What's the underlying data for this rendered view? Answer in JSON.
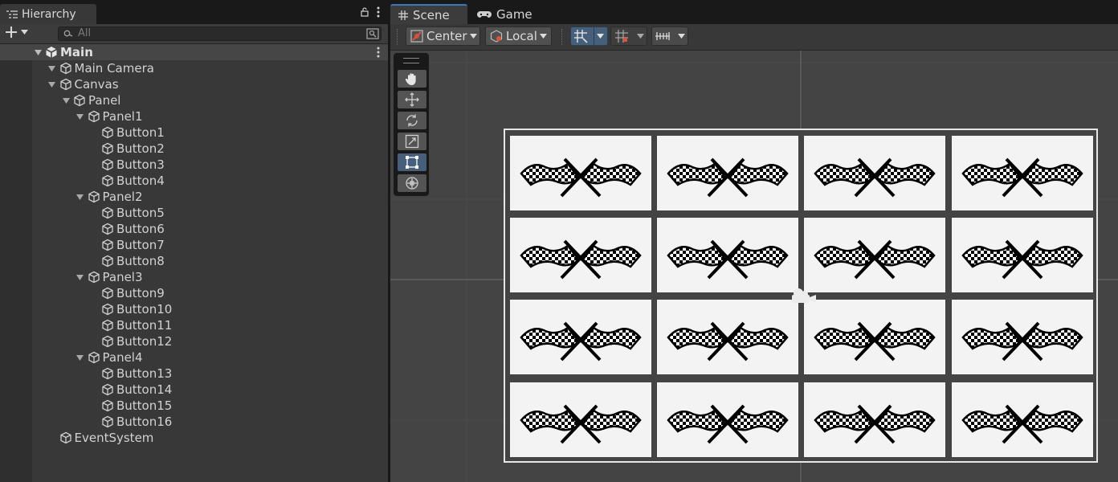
{
  "hierarchy": {
    "tab_label": "Hierarchy",
    "search_placeholder": "All",
    "scene_name": "Main",
    "items": [
      {
        "label": "Main Camera",
        "depth": 1,
        "expandable": true
      },
      {
        "label": "Canvas",
        "depth": 1,
        "expandable": true
      },
      {
        "label": "Panel",
        "depth": 2,
        "expandable": true
      },
      {
        "label": "Panel1",
        "depth": 3,
        "expandable": true
      },
      {
        "label": "Button1",
        "depth": 4,
        "expandable": false
      },
      {
        "label": "Button2",
        "depth": 4,
        "expandable": false
      },
      {
        "label": "Button3",
        "depth": 4,
        "expandable": false
      },
      {
        "label": "Button4",
        "depth": 4,
        "expandable": false
      },
      {
        "label": "Panel2",
        "depth": 3,
        "expandable": true
      },
      {
        "label": "Button5",
        "depth": 4,
        "expandable": false
      },
      {
        "label": "Button6",
        "depth": 4,
        "expandable": false
      },
      {
        "label": "Button7",
        "depth": 4,
        "expandable": false
      },
      {
        "label": "Button8",
        "depth": 4,
        "expandable": false
      },
      {
        "label": "Panel3",
        "depth": 3,
        "expandable": true
      },
      {
        "label": "Button9",
        "depth": 4,
        "expandable": false
      },
      {
        "label": "Button10",
        "depth": 4,
        "expandable": false
      },
      {
        "label": "Button11",
        "depth": 4,
        "expandable": false
      },
      {
        "label": "Button12",
        "depth": 4,
        "expandable": false
      },
      {
        "label": "Panel4",
        "depth": 3,
        "expandable": true
      },
      {
        "label": "Button13",
        "depth": 4,
        "expandable": false
      },
      {
        "label": "Button14",
        "depth": 4,
        "expandable": false
      },
      {
        "label": "Button15",
        "depth": 4,
        "expandable": false
      },
      {
        "label": "Button16",
        "depth": 4,
        "expandable": false
      },
      {
        "label": "EventSystem",
        "depth": 1,
        "expandable": false
      }
    ]
  },
  "scene": {
    "tabs": [
      {
        "label": "Scene",
        "icon": "grid-icon",
        "active": true
      },
      {
        "label": "Game",
        "icon": "gamepad-icon",
        "active": false
      }
    ],
    "toolbar": {
      "pivot_label": "Center",
      "space_label": "Local"
    },
    "tools": [
      "hand-tool",
      "move-tool",
      "rotate-tool",
      "scale-tool",
      "rect-tool",
      "transform-tool"
    ],
    "selected_tool": "rect-tool",
    "card_icon": "checkered-flags-icon",
    "grid": {
      "rows": 4,
      "cols": 4
    }
  },
  "colors": {
    "accent": "#3a79bb",
    "selected_tool": "#46607c",
    "canvas_border": "#e6e6e6",
    "card_bg": "#f3f3f3"
  }
}
